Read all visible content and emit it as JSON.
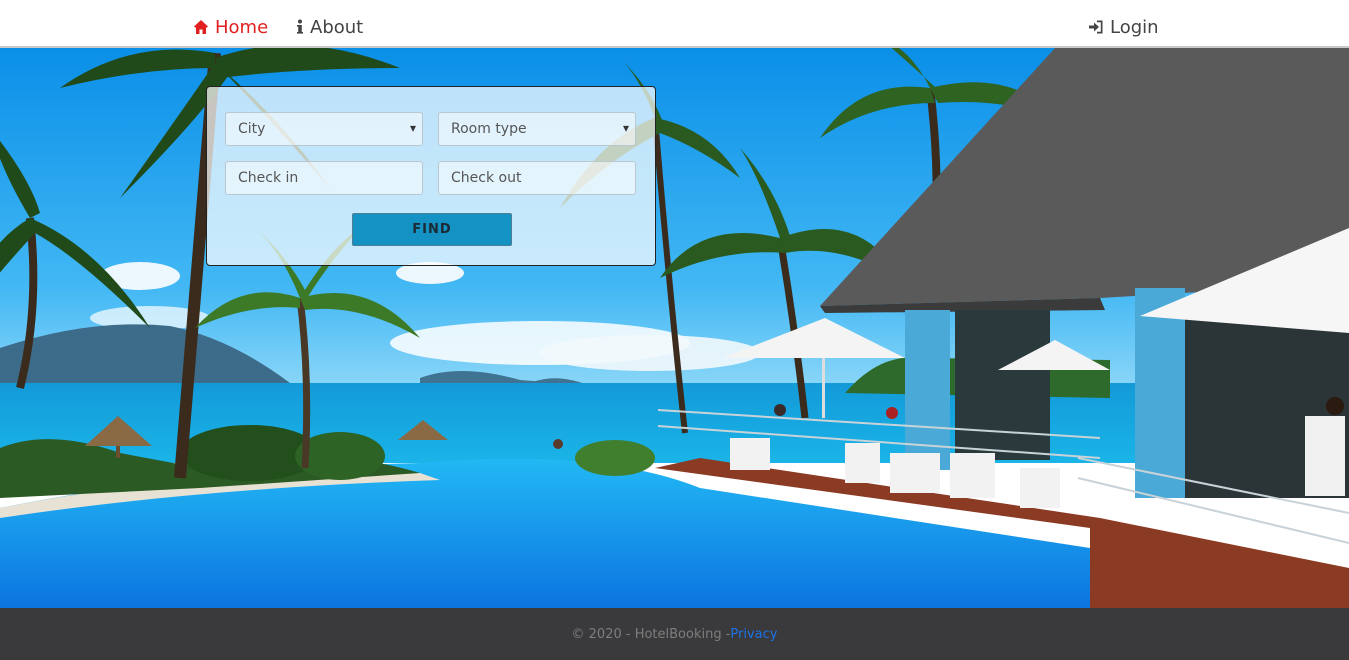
{
  "nav": {
    "home_label": "Home",
    "about_label": "About",
    "login_label": "Login",
    "active_color": "#e02020"
  },
  "search": {
    "city_placeholder": "City",
    "room_type_placeholder": "Room type",
    "check_in_placeholder": "Check in",
    "check_out_placeholder": "Check out",
    "find_label": "FIND"
  },
  "footer": {
    "copyright": "© 2020 - HotelBooking -",
    "privacy_label": "Privacy"
  },
  "icons": {
    "home": "home-icon",
    "about": "info-icon",
    "login": "sign-in-icon"
  }
}
